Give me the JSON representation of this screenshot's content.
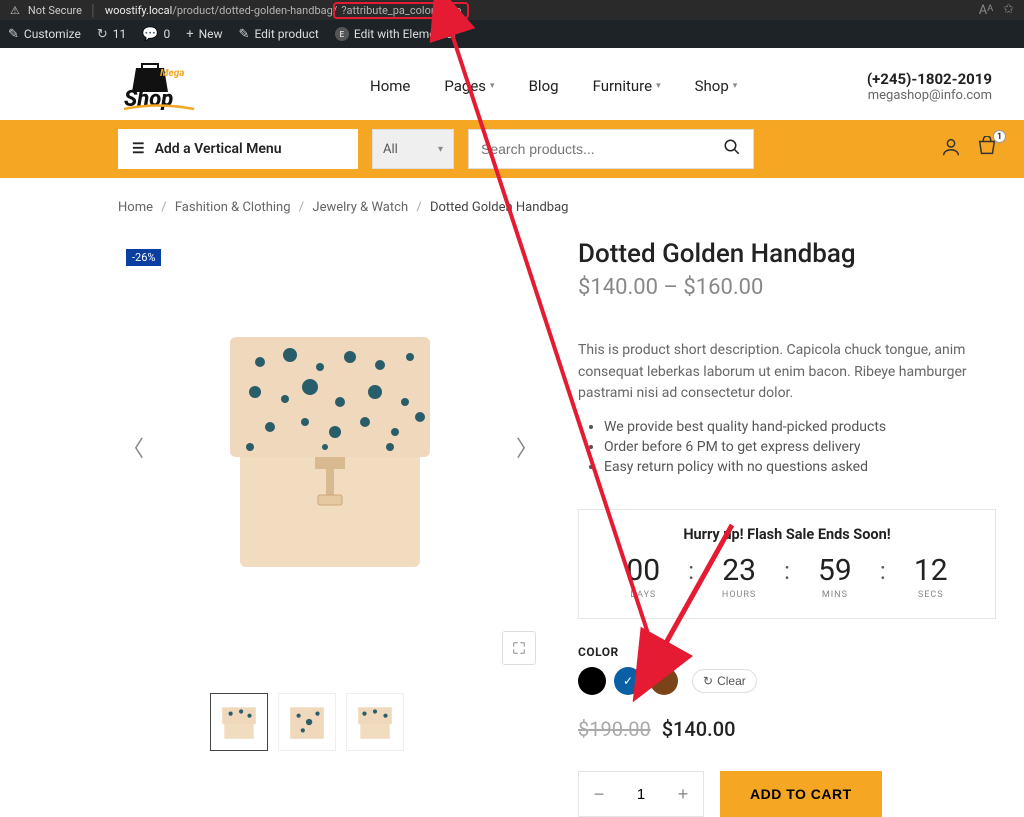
{
  "browser": {
    "security": "Not Secure",
    "host": "woostify.local",
    "path": "/product/dotted-golden-handbag/",
    "query": "?attribute_pa_color=blue"
  },
  "wpbar": {
    "customize": "Customize",
    "updates": "11",
    "comments": "0",
    "new": "New",
    "edit": "Edit product",
    "elementor": "Edit with Elementor"
  },
  "logo": {
    "main": "Shop",
    "sub": "Mega"
  },
  "nav": {
    "home": "Home",
    "pages": "Pages",
    "blog": "Blog",
    "furniture": "Furniture",
    "shop": "Shop"
  },
  "contact": {
    "phone": "(+245)-1802-2019",
    "email": "megashop@info.com"
  },
  "vertical_menu": "Add a Vertical Menu",
  "search": {
    "category": "All",
    "placeholder": "Search products..."
  },
  "cart_count": "1",
  "breadcrumb": {
    "home": "Home",
    "cat1": "Fashition & Clothing",
    "cat2": "Jewelry & Watch",
    "current": "Dotted Golden Handbag"
  },
  "sale_badge": "-26%",
  "product": {
    "name": "Dotted Golden Handbag",
    "price_low": "$140.00",
    "price_high": "$160.00",
    "dash": "–",
    "description": "This is product short description. Capicola chuck tongue, anim consequat leberkas laborum ut enim bacon. Ribeye hamburger pastrami nisi ad consectetur dolor.",
    "bullets": [
      "We provide best quality hand-picked products",
      "Order before 6 PM to get express delivery",
      "Easy return policy with no questions asked"
    ]
  },
  "countdown": {
    "title": "Hurry up! Flash Sale Ends Soon!",
    "days": "00",
    "days_lbl": "DAYS",
    "hours": "23",
    "hours_lbl": "HOURS",
    "mins": "59",
    "mins_lbl": "MINS",
    "secs": "12",
    "secs_lbl": "SECS"
  },
  "color": {
    "label": "COLOR",
    "clear": "Clear",
    "options": [
      "black",
      "blue",
      "brown"
    ],
    "selected": "blue"
  },
  "variation_price": {
    "old": "$190.00",
    "new": "$140.00"
  },
  "qty": "1",
  "add_to_cart": "ADD TO CART"
}
